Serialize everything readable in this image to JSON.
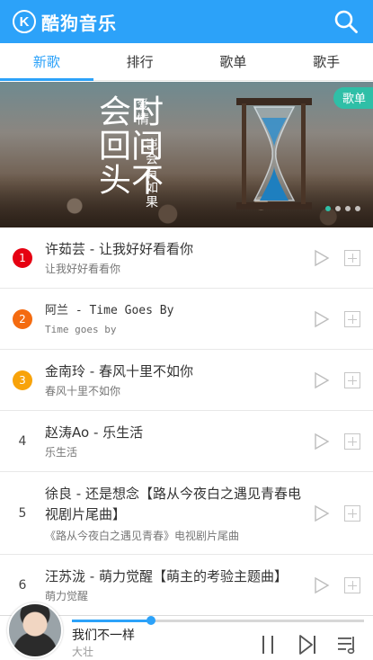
{
  "header": {
    "logo_letter": "K",
    "app_name": "酷狗音乐",
    "search_icon": "search-icon"
  },
  "tabs": [
    {
      "label": "新歌",
      "active": true
    },
    {
      "label": "排行",
      "active": false
    },
    {
      "label": "歌单",
      "active": false
    },
    {
      "label": "歌手",
      "active": false
    }
  ],
  "banner": {
    "badge": "歌单",
    "poem_line1": "时间不会回头",
    "poem_big1": "时",
    "poem_big2": "间",
    "poem_small1": "爱情",
    "poem_small2": "岂会有如果",
    "slide_count": 4,
    "active_slide": 1
  },
  "songs": [
    {
      "rank": "1",
      "title": "许茹芸 - 让我好好看看你",
      "sub": "让我好好看看你"
    },
    {
      "rank": "2",
      "title": "阿兰 - Time Goes By",
      "sub": "Time goes by"
    },
    {
      "rank": "3",
      "title": "金南玲 - 春风十里不如你",
      "sub": "春风十里不如你"
    },
    {
      "rank": "4",
      "title": "赵涛Ao - 乐生活",
      "sub": "乐生活"
    },
    {
      "rank": "5",
      "title": "徐良 - 还是想念【路从今夜白之遇见青春电视剧片尾曲】",
      "sub": "《路从今夜白之遇见青春》电视剧片尾曲"
    },
    {
      "rank": "6",
      "title": "汪苏泷 - 萌力觉醒【萌主的考验主题曲】",
      "sub": "萌力觉醒"
    }
  ],
  "player": {
    "title": "我们不一样",
    "artist": "大壮",
    "progress": 0.27
  },
  "colors": {
    "accent": "#2ca2f9",
    "rank1": "#e60012",
    "rank2": "#f46b10",
    "rank3": "#f8a30a",
    "badge": "#2fbfa7"
  }
}
